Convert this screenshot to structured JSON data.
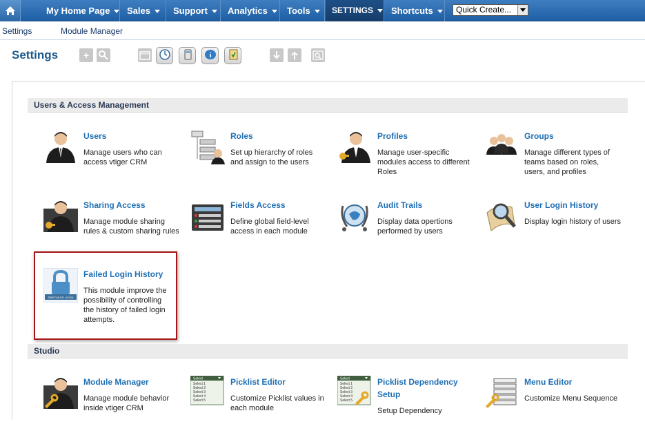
{
  "nav": {
    "items": [
      {
        "label": "My Home Page"
      },
      {
        "label": "Sales"
      },
      {
        "label": "Support"
      },
      {
        "label": "Analytics"
      },
      {
        "label": "Tools"
      },
      {
        "label": "SETTINGS"
      },
      {
        "label": "Shortcuts"
      }
    ],
    "quick_create": "Quick Create..."
  },
  "breadcrumb": {
    "items": [
      "Settings",
      "Module Manager"
    ]
  },
  "page_title": "Settings",
  "sections": [
    {
      "title": "Users & Access Management",
      "items": [
        {
          "title": "Users",
          "desc": "Manage users who can access vtiger CRM",
          "icon": "user-icon"
        },
        {
          "title": "Roles",
          "desc": "Set up hierarchy of roles and assign to the users",
          "icon": "roles-hierarchy-icon"
        },
        {
          "title": "Profiles",
          "desc": "Manage user-specific modules access to different Roles",
          "icon": "profile-key-icon"
        },
        {
          "title": "Groups",
          "desc": "Manage different types of teams based on roles, users, and profiles",
          "icon": "groups-icon"
        },
        {
          "title": "Sharing Access",
          "desc": "Manage module sharing rules & custom sharing rules",
          "icon": "sharing-access-icon"
        },
        {
          "title": "Fields Access",
          "desc": "Define global field-level access in each module",
          "icon": "fields-access-icon"
        },
        {
          "title": "Audit Trails",
          "desc": "Display data opertions performed by users",
          "icon": "audit-trails-icon"
        },
        {
          "title": "User Login History",
          "desc": "Display login history of users",
          "icon": "login-history-icon"
        },
        {
          "title": "Failed Login History",
          "desc": "This module improve the possibility of controlling the history of failed login attempts.",
          "icon": "failed-login-lock-icon",
          "icon_caption": "DBB FAILED LOGIN"
        }
      ]
    },
    {
      "title": "Studio",
      "items": [
        {
          "title": "Module Manager",
          "desc": "Manage module behavior inside vtiger CRM",
          "icon": "module-manager-icon"
        },
        {
          "title": "Picklist Editor",
          "desc": "Customize Picklist values in each module",
          "icon": "picklist-editor-icon",
          "icon_lines": [
            "Select 1",
            "Select 2",
            "Select 3",
            "Select 4",
            "Select 5"
          ],
          "icon_header": "Select"
        },
        {
          "title": "Picklist Dependency Setup",
          "desc": "Setup Dependency",
          "icon": "picklist-dependency-icon",
          "icon_lines": [
            "Select 1",
            "Select 2",
            "Select 3",
            "Select 4",
            "Select 5"
          ],
          "icon_header": "Select"
        },
        {
          "title": "Menu Editor",
          "desc": "Customize Menu Sequence",
          "icon": "menu-editor-icon"
        }
      ]
    }
  ],
  "colors": {
    "nav_blue": "#2a66a8",
    "link_blue": "#1f6fb4",
    "highlight_red": "#a31515"
  }
}
